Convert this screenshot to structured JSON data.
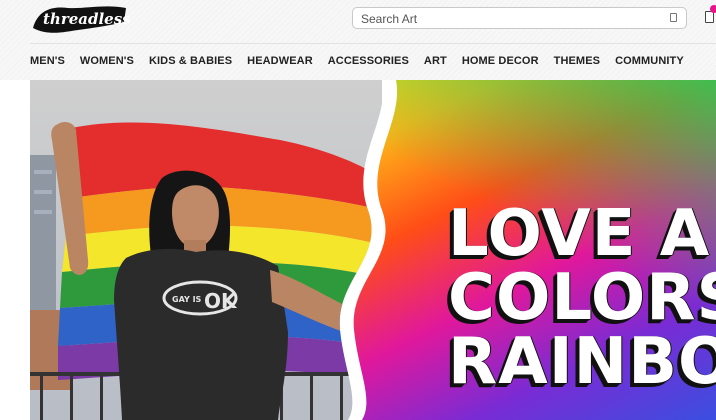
{
  "brand": {
    "logo_text": "threadless"
  },
  "search": {
    "placeholder": "Search Art"
  },
  "nav": {
    "items": [
      "MEN'S",
      "WOMEN'S",
      "KIDS & BABIES",
      "HEADWEAR",
      "ACCESSORIES",
      "ART",
      "HOME DECOR",
      "THEMES",
      "COMMUNITY"
    ]
  },
  "hero": {
    "headline_lines": [
      "LOVE A",
      "COLORS",
      "RAINBO"
    ],
    "shirt_text_gay": "GAY IS",
    "shirt_text_ok": "OK"
  },
  "colors": {
    "badge": "#e7148a",
    "nav_text": "#222222"
  }
}
